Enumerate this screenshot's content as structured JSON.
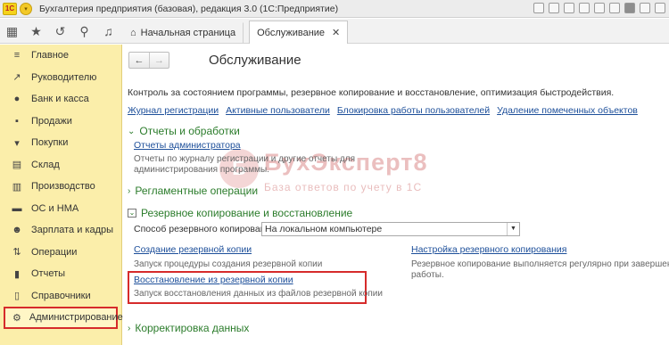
{
  "titlebar": {
    "app_title": "Бухгалтерия предприятия (базовая), редакция 3.0  (1С:Предприятие)",
    "logo_text": "1С"
  },
  "topbar": {
    "icons": [
      "apps-grid-icon",
      "star-icon",
      "history-icon",
      "search-icon",
      "bell-icon"
    ]
  },
  "tabs": [
    {
      "label": "Начальная страница",
      "active": false
    },
    {
      "label": "Обслуживание",
      "active": true
    }
  ],
  "sidebar": {
    "items": [
      {
        "label": "Главное",
        "icon": "menu-icon"
      },
      {
        "label": "Руководителю",
        "icon": "chart-icon"
      },
      {
        "label": "Банк и касса",
        "icon": "bank-icon"
      },
      {
        "label": "Продажи",
        "icon": "sales-icon"
      },
      {
        "label": "Покупки",
        "icon": "cart-icon"
      },
      {
        "label": "Склад",
        "icon": "warehouse-icon"
      },
      {
        "label": "Производство",
        "icon": "factory-icon"
      },
      {
        "label": "ОС и НМА",
        "icon": "assets-icon"
      },
      {
        "label": "Зарплата и кадры",
        "icon": "people-icon"
      },
      {
        "label": "Операции",
        "icon": "operations-icon"
      },
      {
        "label": "Отчеты",
        "icon": "reports-icon"
      },
      {
        "label": "Справочники",
        "icon": "book-icon"
      },
      {
        "label": "Администрирование",
        "icon": "gear-icon"
      }
    ],
    "selected": "Администрирование"
  },
  "main": {
    "title": "Обслуживание",
    "description": "Контроль за состоянием программы, резервное копирование и восстановление, оптимизация быстродействия.",
    "top_links": [
      "Журнал регистрации",
      "Активные пользователи",
      "Блокировка работы пользователей",
      "Удаление помеченных объектов"
    ],
    "section_reports": {
      "title": "Отчеты и обработки",
      "link": "Отчеты администратора",
      "note_line1": "Отчеты по журналу регистрации и другие отчеты для",
      "note_line2": "администрирования программы."
    },
    "section_routine": {
      "title": "Регламентные операции"
    },
    "section_backup": {
      "title": "Резервное копирование и восстановление",
      "method_label": "Способ резервного копирования:",
      "method_value": "На локальном компьютере",
      "create_link": "Создание резервной копии",
      "create_note": "Запуск процедуры создания резервной копии",
      "setup_link": "Настройка резервного копирования",
      "setup_note_line1": "Резервное копирование выполняется регулярно при завершении",
      "setup_note_line2": "работы.",
      "restore_link": "Восстановление из резервной копии",
      "restore_note": "Запуск восстановления данных из файлов резервной копии"
    },
    "section_data_fix": {
      "title": "Корректировка данных"
    }
  },
  "watermark": {
    "brand": "БухЭксперт8",
    "tagline": "База ответов по учету в 1С"
  },
  "colors": {
    "sidebar_bg": "#fbeeaa",
    "link": "#1d4f9a",
    "section": "#2b7c2b",
    "highlight": "#d62b2b"
  }
}
